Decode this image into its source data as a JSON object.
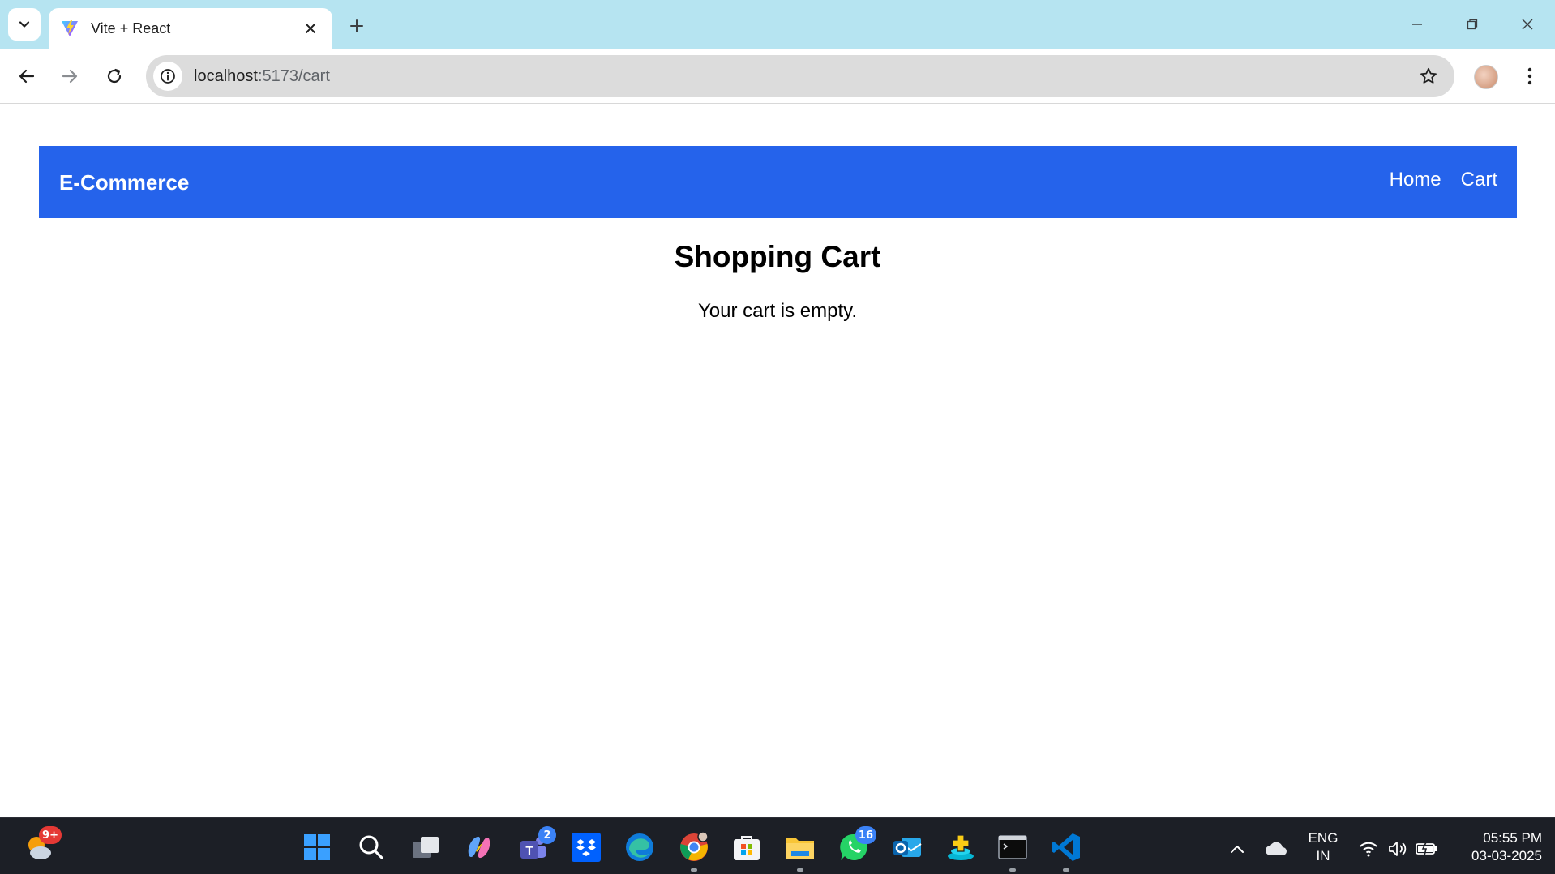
{
  "browser": {
    "tab": {
      "title": "Vite + React"
    },
    "address": {
      "host": "localhost",
      "path": ":5173/cart"
    }
  },
  "navbar": {
    "brand": "E-Commerce",
    "links": [
      {
        "label": "Home"
      },
      {
        "label": "Cart"
      }
    ],
    "bg_color": "#2563eb"
  },
  "cart": {
    "title": "Shopping Cart",
    "empty_message": "Your cart is empty."
  },
  "taskbar": {
    "weather_badge": "9+",
    "teams_badge": "2",
    "whatsapp_badge": "16",
    "language_line1": "ENG",
    "language_line2": "IN",
    "time": "05:55 PM",
    "date": "03-03-2025"
  },
  "icons": {
    "tab_search": "chevron-down-icon",
    "favicon": "vite-icon",
    "tab_close": "close-icon",
    "new_tab": "plus-icon",
    "back": "arrow-left-icon",
    "forward": "arrow-right-icon",
    "reload": "reload-icon",
    "site_info": "info-icon",
    "bookmark": "star-icon",
    "menu": "more-vertical-icon"
  }
}
